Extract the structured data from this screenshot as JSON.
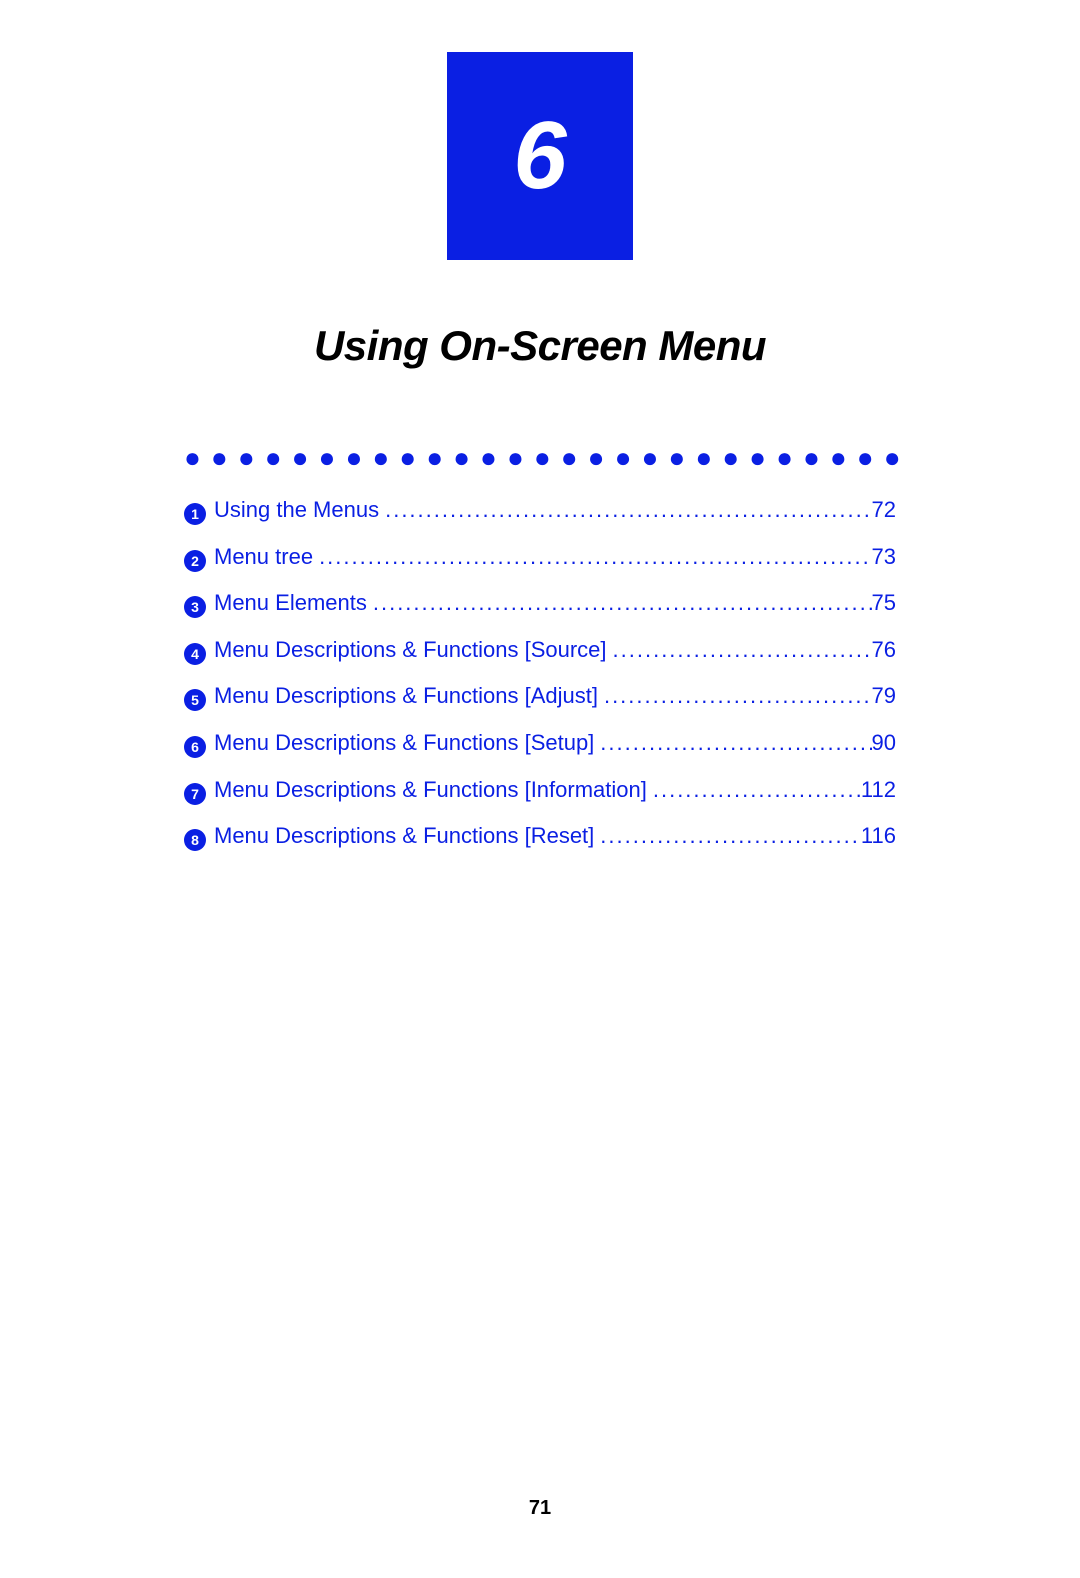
{
  "chapter": {
    "number": "6",
    "title": "Using On-Screen Menu"
  },
  "toc": {
    "items": [
      {
        "num": "1",
        "title": "Using the Menus",
        "page": "72"
      },
      {
        "num": "2",
        "title": "Menu tree",
        "page": "73"
      },
      {
        "num": "3",
        "title": "Menu Elements",
        "page": "75"
      },
      {
        "num": "4",
        "title": "Menu Descriptions & Functions [Source]",
        "page": "76"
      },
      {
        "num": "5",
        "title": "Menu Descriptions & Functions [Adjust]",
        "page": "79"
      },
      {
        "num": "6",
        "title": "Menu Descriptions & Functions [Setup]",
        "page": "90"
      },
      {
        "num": "7",
        "title": "Menu Descriptions & Functions [Information]",
        "page": "112"
      },
      {
        "num": "8",
        "title": "Menu Descriptions & Functions [Reset]",
        "page": "116"
      }
    ]
  },
  "page_number": "71"
}
